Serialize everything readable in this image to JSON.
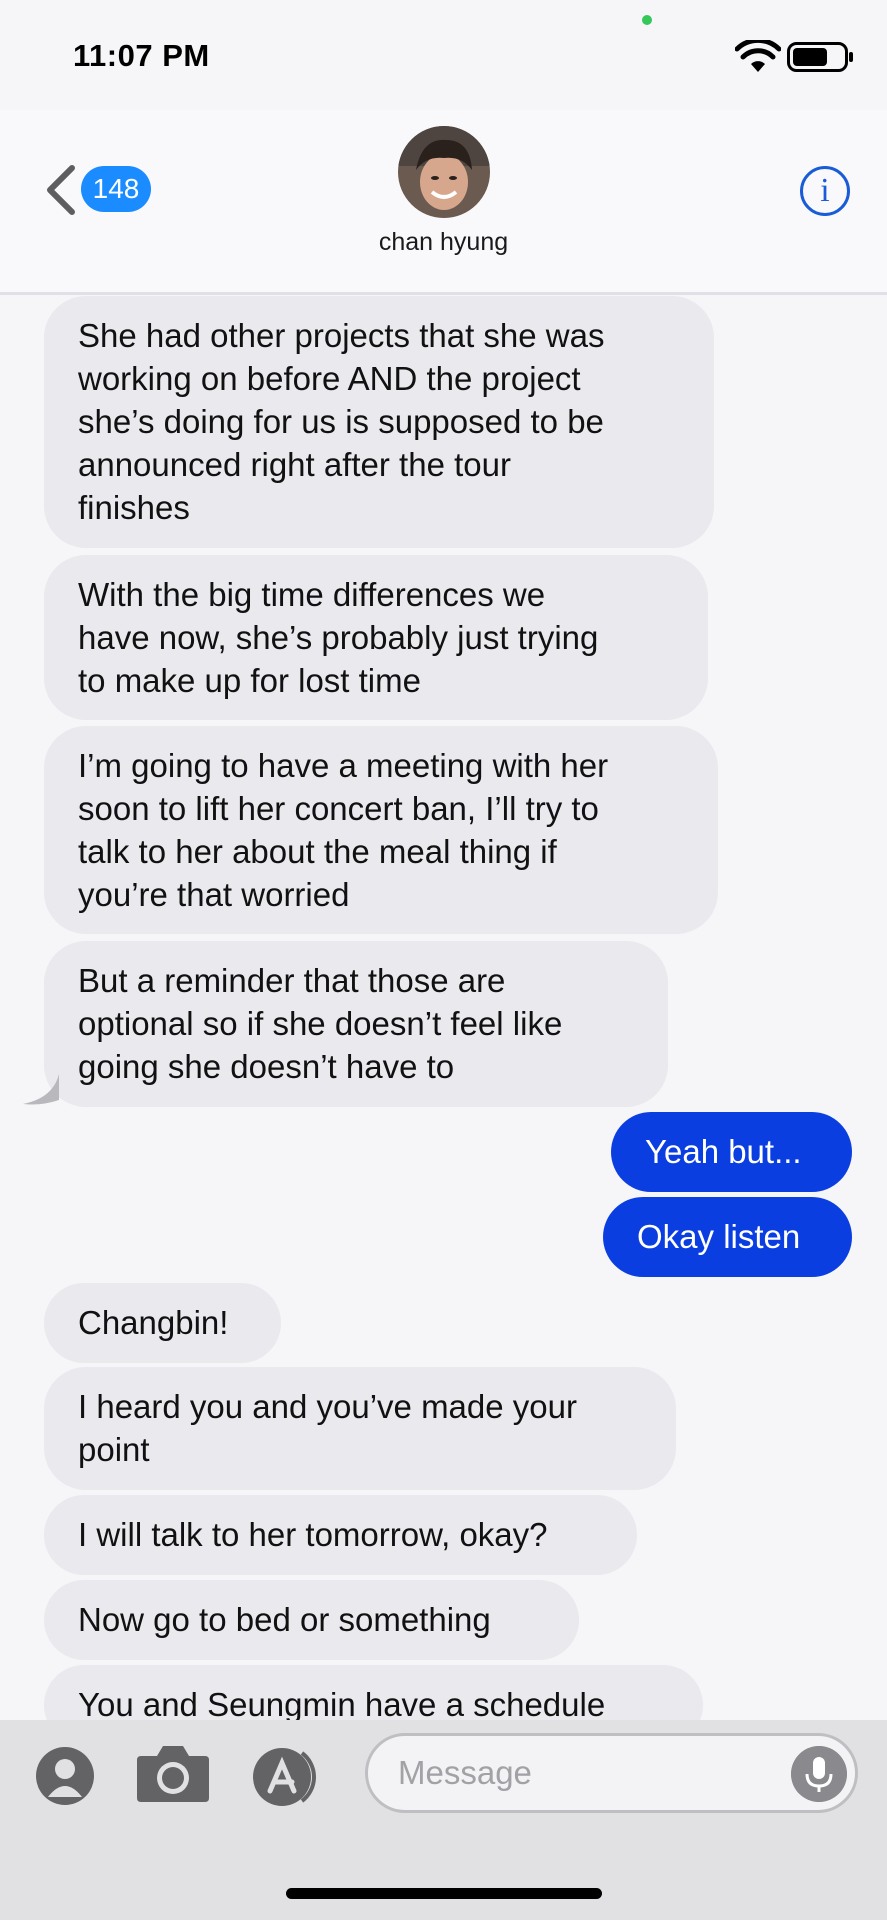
{
  "status_bar": {
    "time": "11:07 PM"
  },
  "header": {
    "back_count": "148",
    "contact_name": "chan hyung",
    "info_label": "i"
  },
  "messages": [
    {
      "from": "them",
      "text": "She had other projects that she was\nworking on before AND the project\nshe’s doing for us is supposed to be\nannounced right after the tour\nfinishes"
    },
    {
      "from": "them",
      "text": "With the big time differences we\nhave now, she’s probably just trying\nto make up for lost time"
    },
    {
      "from": "them",
      "text": "I’m going to have a meeting with her\nsoon to lift her concert ban, I’ll try to\ntalk to her about the meal thing if\nyou’re that worried"
    },
    {
      "from": "them",
      "text": "But a reminder that those are\noptional so if she doesn’t feel like\ngoing she doesn’t have to"
    },
    {
      "from": "me",
      "text": "Yeah but..."
    },
    {
      "from": "me",
      "text": "Okay listen"
    },
    {
      "from": "them",
      "text": "Changbin!"
    },
    {
      "from": "them",
      "text": "I heard you and you’ve made your\npoint"
    },
    {
      "from": "them",
      "text": "I will talk to her tomorrow, okay?"
    },
    {
      "from": "them",
      "text": "Now go to bed or something"
    },
    {
      "from": "them",
      "text": "You and Seungmin have a schedule"
    }
  ],
  "composer": {
    "placeholder": "Message"
  },
  "colors": {
    "incoming_bubble": "#e9e9ee",
    "outgoing_bubble": "#0a3ee0",
    "accent": "#1a8cff"
  }
}
